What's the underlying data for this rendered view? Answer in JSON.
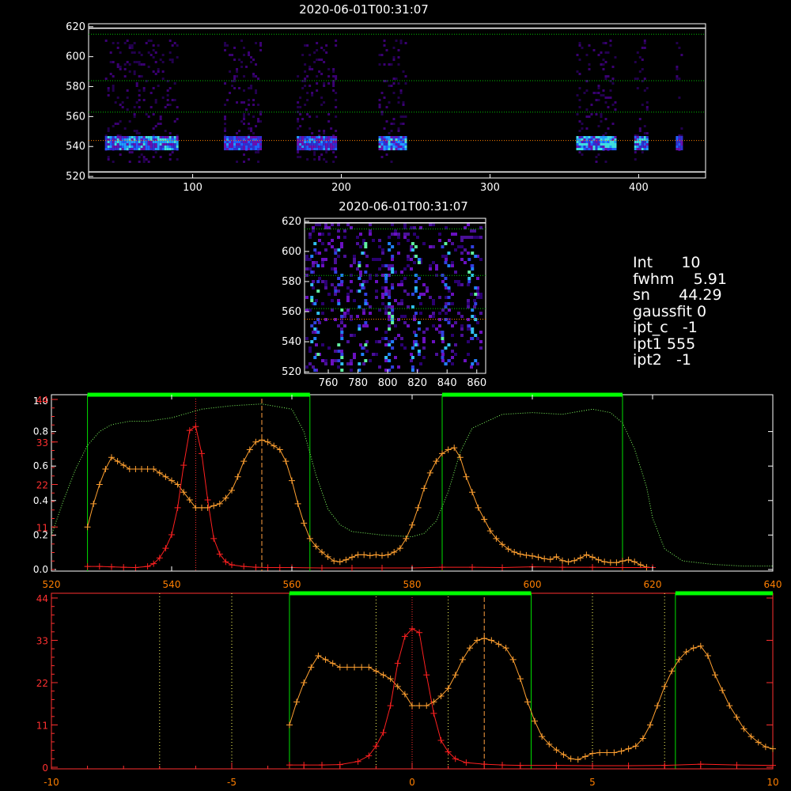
{
  "top_panel": {
    "title": "2020-06-01T00:31:07",
    "x_ticks": [
      "100",
      "200",
      "300",
      "400"
    ],
    "y_ticks": [
      "520",
      "540",
      "560",
      "580",
      "600",
      "620"
    ],
    "xlim": [
      30,
      445
    ],
    "ylim": [
      519,
      622
    ],
    "guide_lines": [
      {
        "y": 615,
        "color": "#00c000"
      },
      {
        "y": 584,
        "color": "#00c000"
      },
      {
        "y": 563,
        "color": "#00c000"
      },
      {
        "y": 544,
        "color": "#ff7f00"
      }
    ],
    "white_lines": [
      619,
      523
    ],
    "emission_blocks": [
      {
        "x0": 41,
        "x1": 90,
        "strength": 0.9
      },
      {
        "x0": 121,
        "x1": 146,
        "strength": 0.6
      },
      {
        "x0": 170,
        "x1": 197,
        "strength": 0.6
      },
      {
        "x0": 225,
        "x1": 244,
        "strength": 1.0
      },
      {
        "x0": 358,
        "x1": 385,
        "strength": 1.0
      },
      {
        "x0": 397,
        "x1": 405,
        "strength": 1.0
      },
      {
        "x0": 425,
        "x1": 429,
        "strength": 0.5
      }
    ]
  },
  "mid_panel": {
    "title": "2020-06-01T00:31:07",
    "x_ticks": [
      "760",
      "780",
      "800",
      "820",
      "840",
      "860"
    ],
    "y_ticks": [
      "520",
      "540",
      "560",
      "580",
      "600",
      "620"
    ],
    "xlim": [
      744,
      866
    ],
    "ylim": [
      519,
      622
    ],
    "guide_lines": [
      {
        "y": 615,
        "color": "#00c000"
      },
      {
        "y": 584,
        "color": "#00c000"
      },
      {
        "y": 562,
        "color": "#00c000"
      },
      {
        "y": 555,
        "color": "#ff7f00"
      }
    ],
    "columns": [
      750,
      766,
      782,
      800,
      818,
      838,
      856
    ]
  },
  "info": {
    "rows": [
      "Int      10",
      "fwhm    5.91",
      "sn      44.29",
      "gaussfit 0",
      "ipt_c   -1",
      "ipt1 555",
      "ipt2   -1"
    ]
  },
  "chart_data": [
    {
      "type": "line",
      "panel": "spectrum",
      "xlim": [
        520,
        640
      ],
      "x_ticks": [
        "520",
        "540",
        "560",
        "580",
        "600",
        "620",
        "640"
      ],
      "y_left_white_ticks": [
        "0.0",
        "0.2",
        "0.4",
        "0.6",
        "0.8"
      ],
      "y_left_red_ticks": [
        "11",
        "22",
        "33",
        "44"
      ],
      "y_left_top_label": "1.0",
      "ylim_norm": [
        0,
        1.0
      ],
      "ylim_counts": [
        0,
        44
      ],
      "green_windows": [
        [
          526,
          563
        ],
        [
          585,
          615
        ]
      ],
      "markers": [
        {
          "x": 544,
          "color": "#ff3030"
        },
        {
          "x": 555,
          "color": "#ff9f40"
        }
      ],
      "series": [
        {
          "color": "#ff2020",
          "x": [
            526,
            528,
            530,
            532,
            534,
            536,
            537,
            538,
            539,
            540,
            541,
            542,
            543,
            544,
            545,
            546,
            547,
            548,
            549,
            550,
            552,
            554,
            556,
            558,
            560,
            565,
            570,
            575,
            580,
            585,
            590,
            595,
            600,
            605,
            610,
            615,
            620
          ],
          "y": [
            0.8,
            0.8,
            0.7,
            0.6,
            0.5,
            0.8,
            1.5,
            3.0,
            5.5,
            9.0,
            16,
            27,
            36,
            37,
            30,
            18,
            8,
            4,
            2,
            1.2,
            0.8,
            0.6,
            0.5,
            0.5,
            0.5,
            0.4,
            0.4,
            0.4,
            0.4,
            0.6,
            0.6,
            0.5,
            0.7,
            0.6,
            0.6,
            0.5,
            0.5
          ]
        },
        {
          "color": "#ffa030",
          "x": [
            526,
            527,
            528,
            529,
            530,
            531,
            532,
            533,
            534,
            535,
            536,
            537,
            538,
            539,
            540,
            541,
            542,
            543,
            544,
            545,
            546,
            547,
            548,
            549,
            550,
            551,
            552,
            553,
            554,
            555,
            556,
            557,
            558,
            559,
            560,
            561,
            562,
            563,
            564,
            565,
            566,
            567,
            568,
            569,
            570,
            571,
            572,
            573,
            574,
            575,
            576,
            577,
            578,
            579,
            580,
            581,
            582,
            583,
            584,
            585,
            586,
            587,
            588,
            589,
            590,
            591,
            592,
            593,
            594,
            595,
            596,
            597,
            598,
            599,
            600,
            601,
            602,
            603,
            604,
            605,
            606,
            607,
            608,
            609,
            610,
            611,
            612,
            613,
            614,
            615,
            616,
            617,
            618,
            619
          ],
          "y": [
            11,
            17,
            22,
            26,
            29,
            28,
            27,
            26,
            26,
            26,
            26,
            26,
            25,
            24,
            23,
            22,
            20,
            18,
            16,
            16,
            16,
            16.5,
            17,
            18.5,
            20.5,
            24,
            28,
            31,
            33,
            33.5,
            33,
            32,
            31,
            28,
            23,
            17,
            12,
            8,
            6,
            4.5,
            3.3,
            2.2,
            2.0,
            2.5,
            3.2,
            3.8,
            3.8,
            3.6,
            3.8,
            3.6,
            3.8,
            4.5,
            5.5,
            8,
            11.5,
            16,
            21,
            25,
            28,
            30,
            31,
            31.5,
            29,
            24,
            20,
            16,
            13,
            10,
            8,
            6.5,
            5.3,
            4.5,
            4,
            3.7,
            3.5,
            3.2,
            2.8,
            2.6,
            3.3,
            2.3,
            2.0,
            2.3,
            3.0,
            3.8,
            3.2,
            2.5,
            2.0,
            1.8,
            1.8,
            2.2,
            2.5,
            2.0,
            1.2,
            0.6
          ]
        },
        {
          "color": "#80ff60",
          "dotted": true,
          "x": [
            520,
            522,
            524,
            526,
            528,
            530,
            533,
            536,
            540,
            545,
            550,
            555,
            560,
            562,
            564,
            566,
            568,
            570,
            575,
            580,
            582,
            584,
            586,
            588,
            590,
            595,
            600,
            605,
            610,
            613,
            615,
            617,
            619,
            620,
            622,
            625,
            630,
            635,
            640
          ],
          "y": [
            0.2,
            0.4,
            0.58,
            0.72,
            0.8,
            0.84,
            0.86,
            0.86,
            0.88,
            0.93,
            0.95,
            0.96,
            0.93,
            0.8,
            0.55,
            0.35,
            0.26,
            0.22,
            0.2,
            0.19,
            0.21,
            0.28,
            0.45,
            0.68,
            0.82,
            0.9,
            0.91,
            0.9,
            0.93,
            0.91,
            0.85,
            0.7,
            0.48,
            0.3,
            0.12,
            0.05,
            0.03,
            0.02,
            0.02
          ]
        }
      ]
    },
    {
      "type": "line",
      "panel": "shifted",
      "xlim": [
        -10,
        10
      ],
      "x_ticks": [
        "-10",
        "-5",
        "0",
        "5",
        "10"
      ],
      "y_left_red_ticks": [
        "0",
        "11",
        "22",
        "33",
        "44"
      ],
      "ylim_counts": [
        0,
        44
      ],
      "green_windows": [
        [
          -3.4,
          3.3
        ],
        [
          7.3,
          10
        ]
      ],
      "yellow_markers": [
        -7,
        -5,
        -1,
        1,
        5,
        7
      ],
      "markers": [
        {
          "x": 0,
          "color": "#ff3030"
        },
        {
          "x": 2,
          "color": "#ff9f40"
        }
      ],
      "series": [
        {
          "color": "#ff2020",
          "x": [
            -3.4,
            -3,
            -2.5,
            -2,
            -1.5,
            -1.2,
            -1,
            -0.8,
            -0.6,
            -0.4,
            -0.2,
            0,
            0.2,
            0.4,
            0.6,
            0.8,
            1,
            1.2,
            1.5,
            2,
            2.5,
            3,
            4,
            5,
            6,
            7,
            8,
            9,
            10
          ],
          "y": [
            0.6,
            0.6,
            0.6,
            0.7,
            1.5,
            3,
            5.5,
            9,
            16,
            27,
            34,
            36,
            35,
            24,
            14,
            7,
            4,
            2.2,
            1.2,
            0.8,
            0.6,
            0.5,
            0.5,
            0.4,
            0.4,
            0.5,
            0.8,
            0.6,
            0.5
          ]
        },
        {
          "color": "#ffa030",
          "x": [
            -3.4,
            -3.2,
            -3.0,
            -2.8,
            -2.6,
            -2.4,
            -2.2,
            -2.0,
            -1.8,
            -1.6,
            -1.4,
            -1.2,
            -1.0,
            -0.8,
            -0.6,
            -0.4,
            -0.2,
            0.0,
            0.2,
            0.4,
            0.6,
            0.8,
            1.0,
            1.2,
            1.4,
            1.6,
            1.8,
            2.0,
            2.2,
            2.4,
            2.6,
            2.8,
            3.0,
            3.2,
            3.4,
            3.6,
            3.8,
            4.0,
            4.2,
            4.4,
            4.6,
            4.8,
            5.0,
            5.2,
            5.4,
            5.6,
            5.8,
            6.0,
            6.2,
            6.4,
            6.6,
            6.8,
            7.0,
            7.2,
            7.4,
            7.6,
            7.8,
            8.0,
            8.2,
            8.4,
            8.6,
            8.8,
            9.0,
            9.2,
            9.4,
            9.6,
            9.8,
            10.0
          ],
          "y": [
            11,
            17,
            22,
            26,
            29,
            28,
            27,
            26,
            26,
            26,
            26,
            26,
            25,
            24,
            23,
            21,
            19,
            16,
            16,
            16,
            17,
            18.5,
            20.5,
            24,
            28,
            31,
            33,
            33.5,
            33,
            32,
            31,
            28,
            23,
            17,
            12,
            8,
            6,
            4.5,
            3.3,
            2.2,
            2.0,
            2.8,
            3.6,
            3.8,
            3.8,
            3.8,
            4.2,
            4.8,
            5.5,
            7.5,
            11,
            16,
            21,
            25,
            28,
            30,
            31,
            31.5,
            29,
            24,
            20,
            16,
            13,
            10,
            8,
            6.5,
            5.3,
            4.8
          ]
        }
      ]
    }
  ]
}
